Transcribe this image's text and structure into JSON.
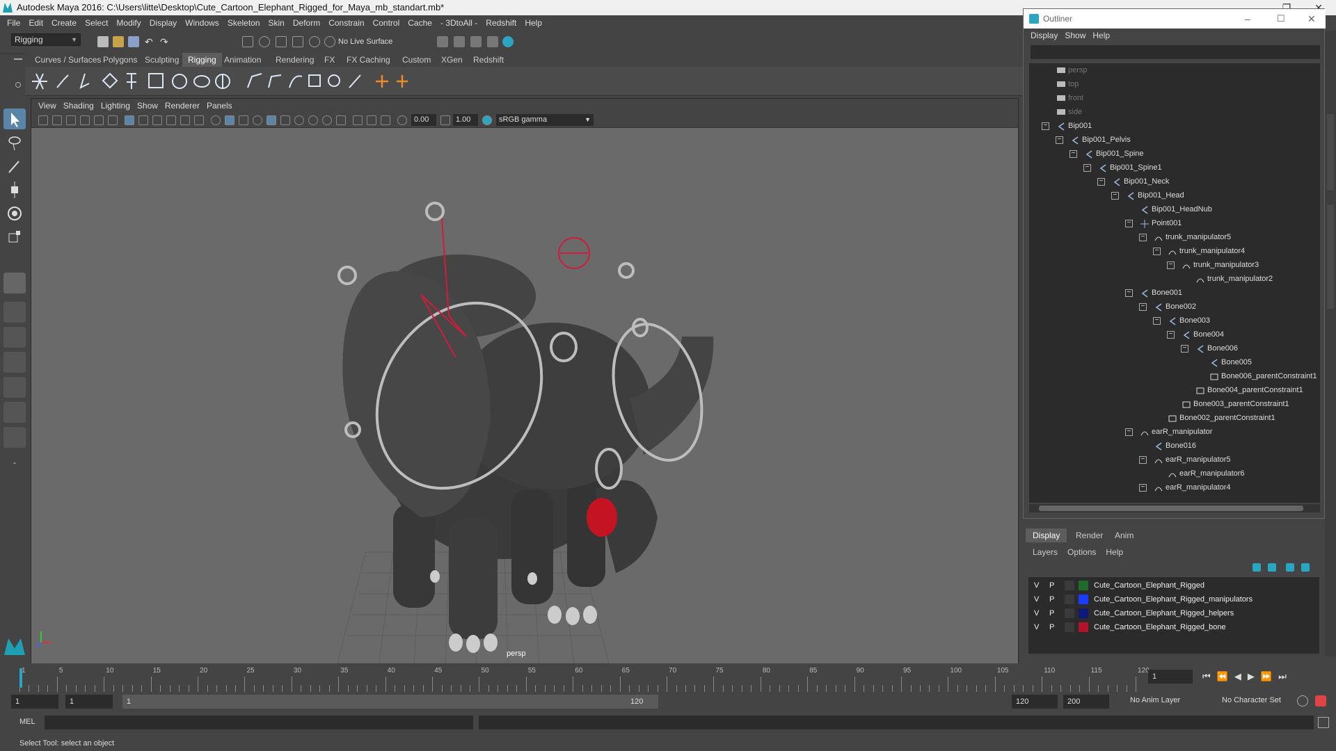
{
  "window": {
    "title": "Autodesk Maya 2016: C:\\Users\\litte\\Desktop\\Cute_Cartoon_Elephant_Rigged_for_Maya_mb_standart.mb*"
  },
  "menubar": [
    "File",
    "Edit",
    "Create",
    "Select",
    "Modify",
    "Display",
    "Windows",
    "Skeleton",
    "Skin",
    "Deform",
    "Constrain",
    "Control",
    "Cache",
    "- 3DtoAll -",
    "Redshift",
    "Help"
  ],
  "toolbar": {
    "menuset": "Rigging",
    "live_surface": "No Live Surface"
  },
  "shelf_tabs": [
    "Curves / Surfaces",
    "Polygons",
    "Sculpting",
    "Rigging",
    "Animation",
    "Rendering",
    "FX",
    "FX Caching",
    "Custom",
    "XGen",
    "Redshift"
  ],
  "shelf_active": "Rigging",
  "viewport": {
    "menu": [
      "View",
      "Shading",
      "Lighting",
      "Show",
      "Renderer",
      "Panels"
    ],
    "exposure": "0.00",
    "gamma": "1.00",
    "color_space": "sRGB gamma",
    "camera_label": "persp"
  },
  "outliner": {
    "title": "Outliner",
    "menu": [
      "Display",
      "Show",
      "Help"
    ],
    "items": [
      {
        "label": "persp",
        "depth": 0,
        "exp": "",
        "icon": "camera-icon",
        "dim": true
      },
      {
        "label": "top",
        "depth": 0,
        "exp": "",
        "icon": "camera-icon",
        "dim": true
      },
      {
        "label": "front",
        "depth": 0,
        "exp": "",
        "icon": "camera-icon",
        "dim": true
      },
      {
        "label": "side",
        "depth": 0,
        "exp": "",
        "icon": "camera-icon",
        "dim": true
      },
      {
        "label": "Bip001",
        "depth": 0,
        "exp": "−",
        "icon": "joint-icon"
      },
      {
        "label": "Bip001_Pelvis",
        "depth": 1,
        "exp": "−",
        "icon": "joint-icon"
      },
      {
        "label": "Bip001_Spine",
        "depth": 2,
        "exp": "−",
        "icon": "joint-icon"
      },
      {
        "label": "Bip001_Spine1",
        "depth": 3,
        "exp": "−",
        "icon": "joint-icon"
      },
      {
        "label": "Bip001_Neck",
        "depth": 4,
        "exp": "−",
        "icon": "joint-icon"
      },
      {
        "label": "Bip001_Head",
        "depth": 5,
        "exp": "−",
        "icon": "joint-icon"
      },
      {
        "label": "Bip001_HeadNub",
        "depth": 6,
        "exp": "",
        "icon": "joint-icon"
      },
      {
        "label": "Point001",
        "depth": 6,
        "exp": "−",
        "icon": "locator-icon"
      },
      {
        "label": "trunk_manipulator5",
        "depth": 7,
        "exp": "−",
        "icon": "curve-icon"
      },
      {
        "label": "trunk_manipulator4",
        "depth": 8,
        "exp": "−",
        "icon": "curve-icon"
      },
      {
        "label": "trunk_manipulator3",
        "depth": 9,
        "exp": "−",
        "icon": "curve-icon"
      },
      {
        "label": "trunk_manipulator2",
        "depth": 10,
        "exp": "",
        "icon": "curve-icon"
      },
      {
        "label": "Bone001",
        "depth": 6,
        "exp": "−",
        "icon": "joint-icon"
      },
      {
        "label": "Bone002",
        "depth": 7,
        "exp": "−",
        "icon": "joint-icon"
      },
      {
        "label": "Bone003",
        "depth": 8,
        "exp": "−",
        "icon": "joint-icon"
      },
      {
        "label": "Bone004",
        "depth": 9,
        "exp": "−",
        "icon": "joint-icon"
      },
      {
        "label": "Bone006",
        "depth": 10,
        "exp": "−",
        "icon": "joint-icon"
      },
      {
        "label": "Bone005",
        "depth": 11,
        "exp": "",
        "icon": "joint-icon"
      },
      {
        "label": "Bone006_parentConstraint1",
        "depth": 11,
        "exp": "",
        "icon": "constraint-icon"
      },
      {
        "label": "Bone004_parentConstraint1",
        "depth": 10,
        "exp": "",
        "icon": "constraint-icon"
      },
      {
        "label": "Bone003_parentConstraint1",
        "depth": 9,
        "exp": "",
        "icon": "constraint-icon"
      },
      {
        "label": "Bone002_parentConstraint1",
        "depth": 8,
        "exp": "",
        "icon": "constraint-icon"
      },
      {
        "label": "earR_manipulator",
        "depth": 6,
        "exp": "−",
        "icon": "curve-icon"
      },
      {
        "label": "Bone016",
        "depth": 7,
        "exp": "",
        "icon": "joint-icon"
      },
      {
        "label": "earR_manipulator5",
        "depth": 7,
        "exp": "−",
        "icon": "curve-icon"
      },
      {
        "label": "earR_manipulator6",
        "depth": 8,
        "exp": "",
        "icon": "curve-icon"
      },
      {
        "label": "earR_manipulator4",
        "depth": 7,
        "exp": "−",
        "icon": "curve-icon"
      }
    ]
  },
  "layer_editor": {
    "tabs": [
      "Display",
      "Render",
      "Anim"
    ],
    "menu": [
      "Layers",
      "Options",
      "Help"
    ],
    "layers": [
      {
        "v": "V",
        "p": "P",
        "color": "#1f6b2a",
        "name": "Cute_Cartoon_Elephant_Rigged"
      },
      {
        "v": "V",
        "p": "P",
        "color": "#1a3cff",
        "name": "Cute_Cartoon_Elephant_Rigged_manipulators"
      },
      {
        "v": "V",
        "p": "P",
        "color": "#0d1a7a",
        "name": "Cute_Cartoon_Elephant_Rigged_helpers"
      },
      {
        "v": "V",
        "p": "P",
        "color": "#b3132a",
        "name": "Cute_Cartoon_Elephant_Rigged_bone"
      }
    ]
  },
  "timeline": {
    "ticks": [
      "1",
      "5",
      "10",
      "15",
      "20",
      "25",
      "30",
      "35",
      "40",
      "45",
      "50",
      "55",
      "60",
      "65",
      "70",
      "75",
      "80",
      "85",
      "90",
      "95",
      "100",
      "105",
      "110",
      "115",
      "120"
    ],
    "current_frame": "1",
    "start": "1",
    "playback_start": "1",
    "range_start_label": "1",
    "range_end_label": "120",
    "playback_end": "120",
    "end": "200",
    "anim_layer": "No Anim Layer",
    "char_set": "No Character Set"
  },
  "cmdline": {
    "label": "MEL"
  },
  "helpline": {
    "text": "Select Tool: select an object"
  }
}
